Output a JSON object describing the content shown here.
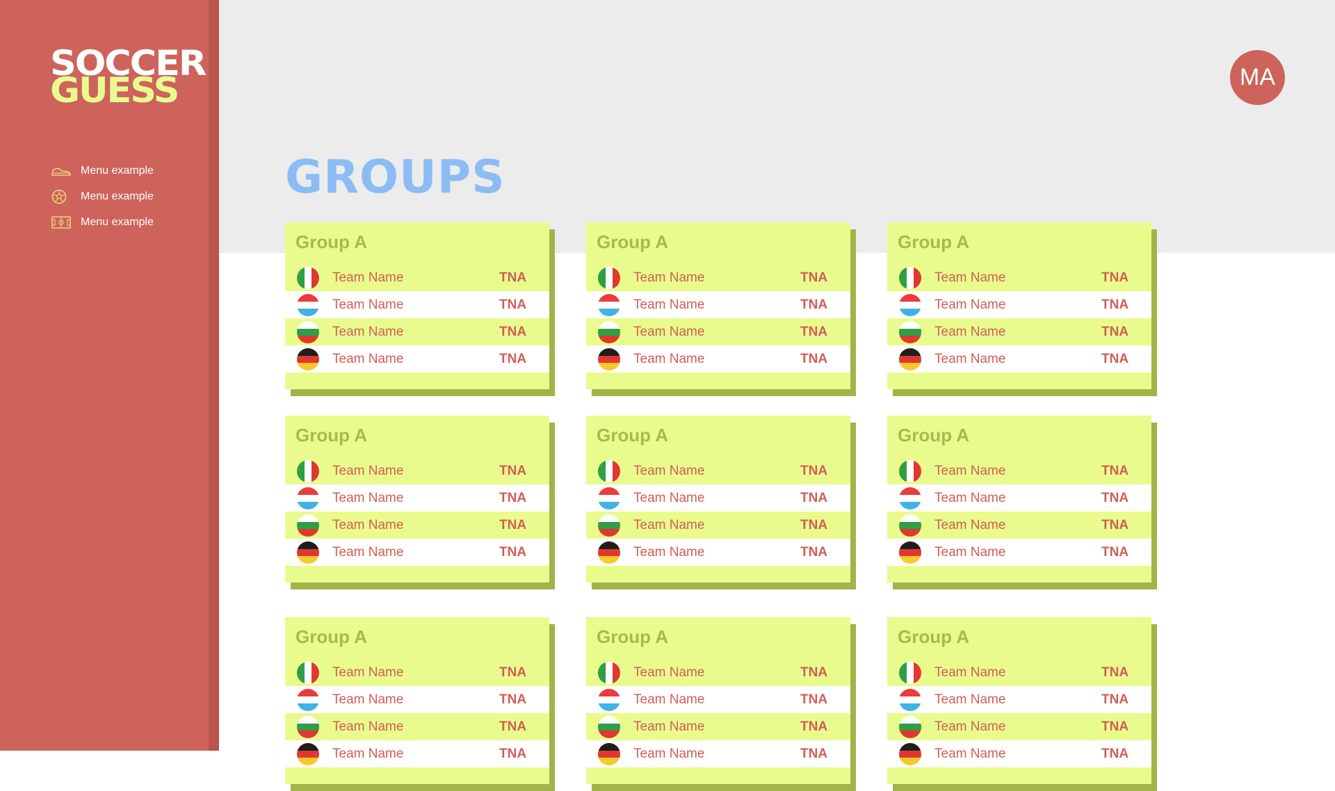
{
  "app": {
    "logo_line1": "SOCCER",
    "logo_line2": "GUESS"
  },
  "colors": {
    "sidebar": "#cd635b",
    "accent_yellow": "#e9fb8d",
    "title_blue": "#8bbdf4",
    "text_red": "#d05e55"
  },
  "sidebar": {
    "items": [
      {
        "label": "Menu example",
        "icon": "soccer-shoe-icon"
      },
      {
        "label": "Menu example",
        "icon": "soccer-ball-icon"
      },
      {
        "label": "Menu example",
        "icon": "soccer-field-icon"
      }
    ]
  },
  "user": {
    "initials": "MA"
  },
  "main": {
    "title": "GROUPS",
    "groups": [
      {
        "name": "Group A",
        "teams": [
          {
            "name": "Team Name",
            "abbr": "TNA",
            "flag": "italy-flag-icon"
          },
          {
            "name": "Team Name",
            "abbr": "TNA",
            "flag": "luxembourg-flag-icon"
          },
          {
            "name": "Team Name",
            "abbr": "TNA",
            "flag": "bulgaria-flag-icon"
          },
          {
            "name": "Team Name",
            "abbr": "TNA",
            "flag": "germany-flag-icon"
          }
        ]
      },
      {
        "name": "Group A",
        "teams": [
          {
            "name": "Team Name",
            "abbr": "TNA",
            "flag": "italy-flag-icon"
          },
          {
            "name": "Team Name",
            "abbr": "TNA",
            "flag": "luxembourg-flag-icon"
          },
          {
            "name": "Team Name",
            "abbr": "TNA",
            "flag": "bulgaria-flag-icon"
          },
          {
            "name": "Team Name",
            "abbr": "TNA",
            "flag": "germany-flag-icon"
          }
        ]
      },
      {
        "name": "Group A",
        "teams": [
          {
            "name": "Team Name",
            "abbr": "TNA",
            "flag": "italy-flag-icon"
          },
          {
            "name": "Team Name",
            "abbr": "TNA",
            "flag": "luxembourg-flag-icon"
          },
          {
            "name": "Team Name",
            "abbr": "TNA",
            "flag": "bulgaria-flag-icon"
          },
          {
            "name": "Team Name",
            "abbr": "TNA",
            "flag": "germany-flag-icon"
          }
        ]
      },
      {
        "name": "Group A",
        "teams": [
          {
            "name": "Team Name",
            "abbr": "TNA",
            "flag": "italy-flag-icon"
          },
          {
            "name": "Team Name",
            "abbr": "TNA",
            "flag": "luxembourg-flag-icon"
          },
          {
            "name": "Team Name",
            "abbr": "TNA",
            "flag": "bulgaria-flag-icon"
          },
          {
            "name": "Team Name",
            "abbr": "TNA",
            "flag": "germany-flag-icon"
          }
        ]
      },
      {
        "name": "Group A",
        "teams": [
          {
            "name": "Team Name",
            "abbr": "TNA",
            "flag": "italy-flag-icon"
          },
          {
            "name": "Team Name",
            "abbr": "TNA",
            "flag": "luxembourg-flag-icon"
          },
          {
            "name": "Team Name",
            "abbr": "TNA",
            "flag": "bulgaria-flag-icon"
          },
          {
            "name": "Team Name",
            "abbr": "TNA",
            "flag": "germany-flag-icon"
          }
        ]
      },
      {
        "name": "Group A",
        "teams": [
          {
            "name": "Team Name",
            "abbr": "TNA",
            "flag": "italy-flag-icon"
          },
          {
            "name": "Team Name",
            "abbr": "TNA",
            "flag": "luxembourg-flag-icon"
          },
          {
            "name": "Team Name",
            "abbr": "TNA",
            "flag": "bulgaria-flag-icon"
          },
          {
            "name": "Team Name",
            "abbr": "TNA",
            "flag": "germany-flag-icon"
          }
        ]
      },
      {
        "name": "Group A",
        "teams": [
          {
            "name": "Team Name",
            "abbr": "TNA",
            "flag": "italy-flag-icon"
          },
          {
            "name": "Team Name",
            "abbr": "TNA",
            "flag": "luxembourg-flag-icon"
          },
          {
            "name": "Team Name",
            "abbr": "TNA",
            "flag": "bulgaria-flag-icon"
          },
          {
            "name": "Team Name",
            "abbr": "TNA",
            "flag": "germany-flag-icon"
          }
        ]
      },
      {
        "name": "Group A",
        "teams": [
          {
            "name": "Team Name",
            "abbr": "TNA",
            "flag": "italy-flag-icon"
          },
          {
            "name": "Team Name",
            "abbr": "TNA",
            "flag": "luxembourg-flag-icon"
          },
          {
            "name": "Team Name",
            "abbr": "TNA",
            "flag": "bulgaria-flag-icon"
          },
          {
            "name": "Team Name",
            "abbr": "TNA",
            "flag": "germany-flag-icon"
          }
        ]
      },
      {
        "name": "Group A",
        "teams": [
          {
            "name": "Team Name",
            "abbr": "TNA",
            "flag": "italy-flag-icon"
          },
          {
            "name": "Team Name",
            "abbr": "TNA",
            "flag": "luxembourg-flag-icon"
          },
          {
            "name": "Team Name",
            "abbr": "TNA",
            "flag": "bulgaria-flag-icon"
          },
          {
            "name": "Team Name",
            "abbr": "TNA",
            "flag": "germany-flag-icon"
          }
        ]
      }
    ]
  }
}
